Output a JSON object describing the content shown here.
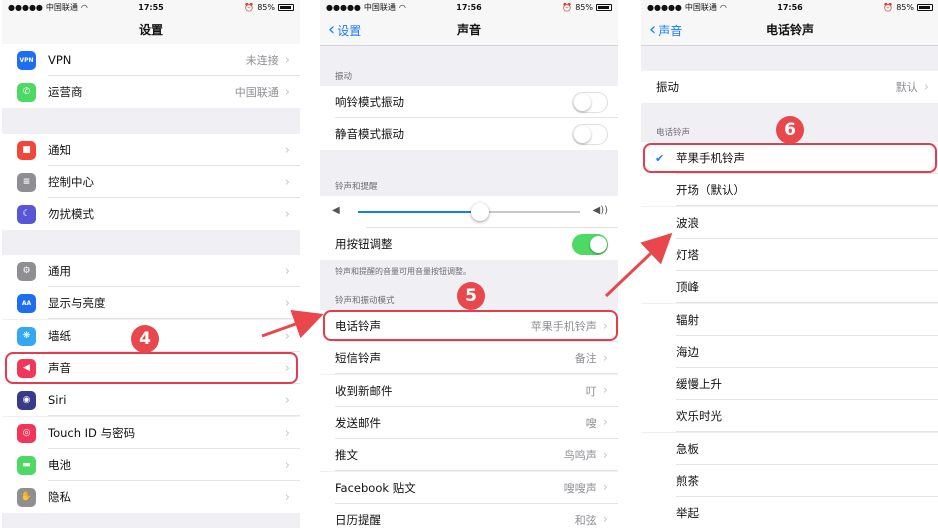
{
  "colors": {
    "accent": "#1a7cf5",
    "highlight": "#e23c4f",
    "badge": "#e8474c",
    "toggle_on": "#4cd964"
  },
  "screen1": {
    "status": {
      "carrier": "中国联通",
      "time": "17:55",
      "battery": "85%"
    },
    "title": "设置",
    "rows": [
      {
        "label": "VPN",
        "value": "未连接",
        "icon": "vpn-icon",
        "color": "#1d6ef2",
        "glyph": "VPN"
      },
      {
        "label": "运营商",
        "value": "中国联通",
        "icon": "phone-icon",
        "color": "#4cd964",
        "glyph": "✆"
      },
      {
        "label": "通知",
        "value": "",
        "icon": "notification-icon",
        "color": "#f2463a",
        "glyph": "■"
      },
      {
        "label": "控制中心",
        "value": "",
        "icon": "control-center-icon",
        "color": "#8e8e93",
        "glyph": "≡"
      },
      {
        "label": "勿扰模式",
        "value": "",
        "icon": "moon-icon",
        "color": "#5856d6",
        "glyph": "☾"
      },
      {
        "label": "通用",
        "value": "",
        "icon": "gear-icon",
        "color": "#8e8e93",
        "glyph": "⚙"
      },
      {
        "label": "显示与亮度",
        "value": "",
        "icon": "display-icon",
        "color": "#1d6ef2",
        "glyph": "AA"
      },
      {
        "label": "墙纸",
        "value": "",
        "icon": "wallpaper-icon",
        "color": "#31a8f0",
        "glyph": "❋"
      },
      {
        "label": "声音",
        "value": "",
        "icon": "speaker-icon",
        "color": "#f2365a",
        "glyph": "◀"
      },
      {
        "label": "Siri",
        "value": "",
        "icon": "siri-icon",
        "color": "#3a3a8c",
        "glyph": "◉"
      },
      {
        "label": "Touch ID 与密码",
        "value": "",
        "icon": "fingerprint-icon",
        "color": "#f2365a",
        "glyph": "◎"
      },
      {
        "label": "电池",
        "value": "",
        "icon": "battery-icon",
        "color": "#4cd964",
        "glyph": "▬"
      },
      {
        "label": "隐私",
        "value": "",
        "icon": "hand-icon",
        "color": "#8e8e93",
        "glyph": "✋"
      }
    ],
    "badge": "4"
  },
  "screen2": {
    "status": {
      "carrier": "中国联通",
      "time": "17:56",
      "battery": "85%"
    },
    "back": "设置",
    "title": "声音",
    "vibrate_header": "振动",
    "vibrate_rows": [
      {
        "label": "响铃模式振动",
        "on": false
      },
      {
        "label": "静音模式振动",
        "on": false
      }
    ],
    "ringer_header": "铃声和提醒",
    "volume_level": 0.55,
    "button_adjust": {
      "label": "用按钮调整",
      "on": true
    },
    "footer": "铃声和提醒的音量可用音量按钮调整。",
    "patterns_header": "铃声和振动模式",
    "rows": [
      {
        "label": "电话铃声",
        "value": "苹果手机铃声"
      },
      {
        "label": "短信铃声",
        "value": "备注"
      },
      {
        "label": "收到新邮件",
        "value": "叮"
      },
      {
        "label": "发送邮件",
        "value": "嗖"
      },
      {
        "label": "推文",
        "value": "鸟鸣声"
      },
      {
        "label": "Facebook 贴文",
        "value": "嗖嗖声"
      },
      {
        "label": "日历提醒",
        "value": "和弦"
      }
    ],
    "badge": "5"
  },
  "screen3": {
    "status": {
      "carrier": "中国联通",
      "time": "17:56",
      "battery": "85%"
    },
    "back": "声音",
    "title": "电话铃声",
    "vibrate": {
      "label": "振动",
      "value": "默认"
    },
    "tones_header": "电话铃声",
    "tones": [
      "苹果手机铃声",
      "开场（默认）",
      "波浪",
      "灯塔",
      "顶峰",
      "辐射",
      "海边",
      "缓慢上升",
      "欢乐时光",
      "急板",
      "煎茶",
      "举起"
    ],
    "selected": 0,
    "badge": "6"
  }
}
